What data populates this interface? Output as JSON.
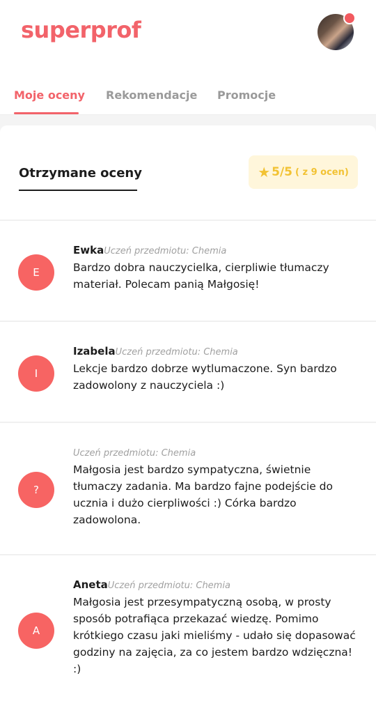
{
  "header": {
    "logo": "superprof"
  },
  "tabs": [
    {
      "label": "Moje oceny"
    },
    {
      "label": "Rekomendacje"
    },
    {
      "label": "Promocje"
    }
  ],
  "section": {
    "title": "Otrzymane oceny",
    "rating": {
      "value": "5/5",
      "count": "( z 9 ocen)"
    }
  },
  "reviews": [
    {
      "initial": "E",
      "name": "Ewka",
      "subject": "Uczeń przedmiotu: Chemia",
      "text": "Bardzo dobra nauczycielka, cierpliwie tłumaczy materiał. Polecam panią Małgosię!"
    },
    {
      "initial": "I",
      "name": "Izabela",
      "subject": "Uczeń przedmiotu: Chemia",
      "text": "Lekcje bardzo dobrze wytlumaczone. Syn bardzo zadowolony z nauczyciela :)"
    },
    {
      "initial": "?",
      "name": "",
      "subject": "Uczeń przedmiotu: Chemia",
      "text": "Małgosia jest bardzo sympatyczna, świetnie tłumaczy zadania. Ma bardzo fajne podejście do ucznia i dużo cierpliwości :) Córka bardzo zadowolona."
    },
    {
      "initial": "A",
      "name": "Aneta",
      "subject": "Uczeń przedmiotu: Chemia",
      "text": "Małgosia jest przesympatyczną osobą, w prosty sposób potrafiąca przekazać wiedzę. Pomimo krótkiego czasu jaki mieliśmy - udało się dopasować godziny na zajęcia, za co jestem bardzo wdzięczna! :)"
    }
  ]
}
